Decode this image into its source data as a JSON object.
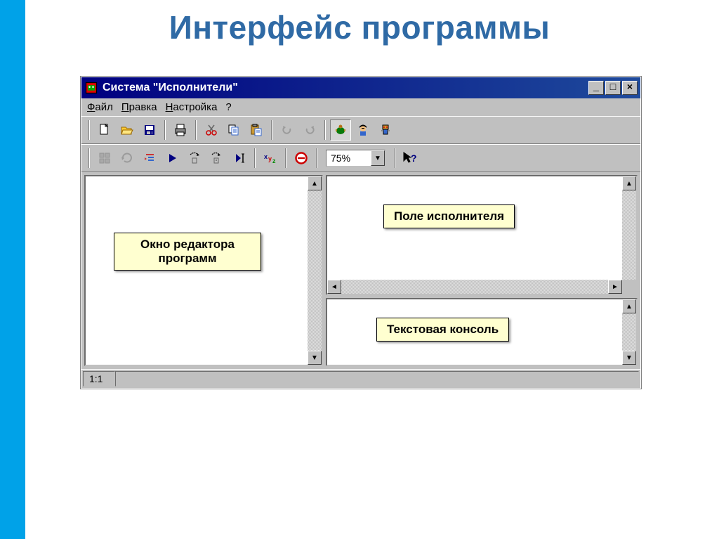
{
  "page_title": "Интерфейс программы",
  "window": {
    "title": "Система \"Исполнители\"",
    "controls": {
      "min": "_",
      "max": "□",
      "close": "×"
    }
  },
  "menu": {
    "file": "Файл",
    "edit": "Правка",
    "settings": "Настройка",
    "help": "?"
  },
  "toolbar": {
    "zoom": "75%",
    "icons": {
      "new": "new-icon",
      "open": "open-icon",
      "save": "save-icon",
      "print": "print-icon",
      "cut": "cut-icon",
      "copy": "copy-icon",
      "paste": "paste-icon",
      "undo": "undo-icon",
      "redo": "redo-icon",
      "turtle": "turtle-icon",
      "pirate": "pirate-icon",
      "robot": "robot-icon"
    }
  },
  "toolbar2": {
    "icons": {
      "tile": "tile-icon",
      "refresh": "refresh-icon",
      "format": "format-icon",
      "run": "run-icon",
      "step": "step-icon",
      "stepover": "stepover-icon",
      "tocursor": "tocursor-icon",
      "vars": "vars-icon",
      "stop": "stop-icon",
      "whatsthis": "whatsthis-icon"
    }
  },
  "labels": {
    "editor": "Окно редактора программ",
    "field": "Поле исполнителя",
    "console": "Текстовая консоль"
  },
  "status": {
    "pos": "1:1"
  }
}
